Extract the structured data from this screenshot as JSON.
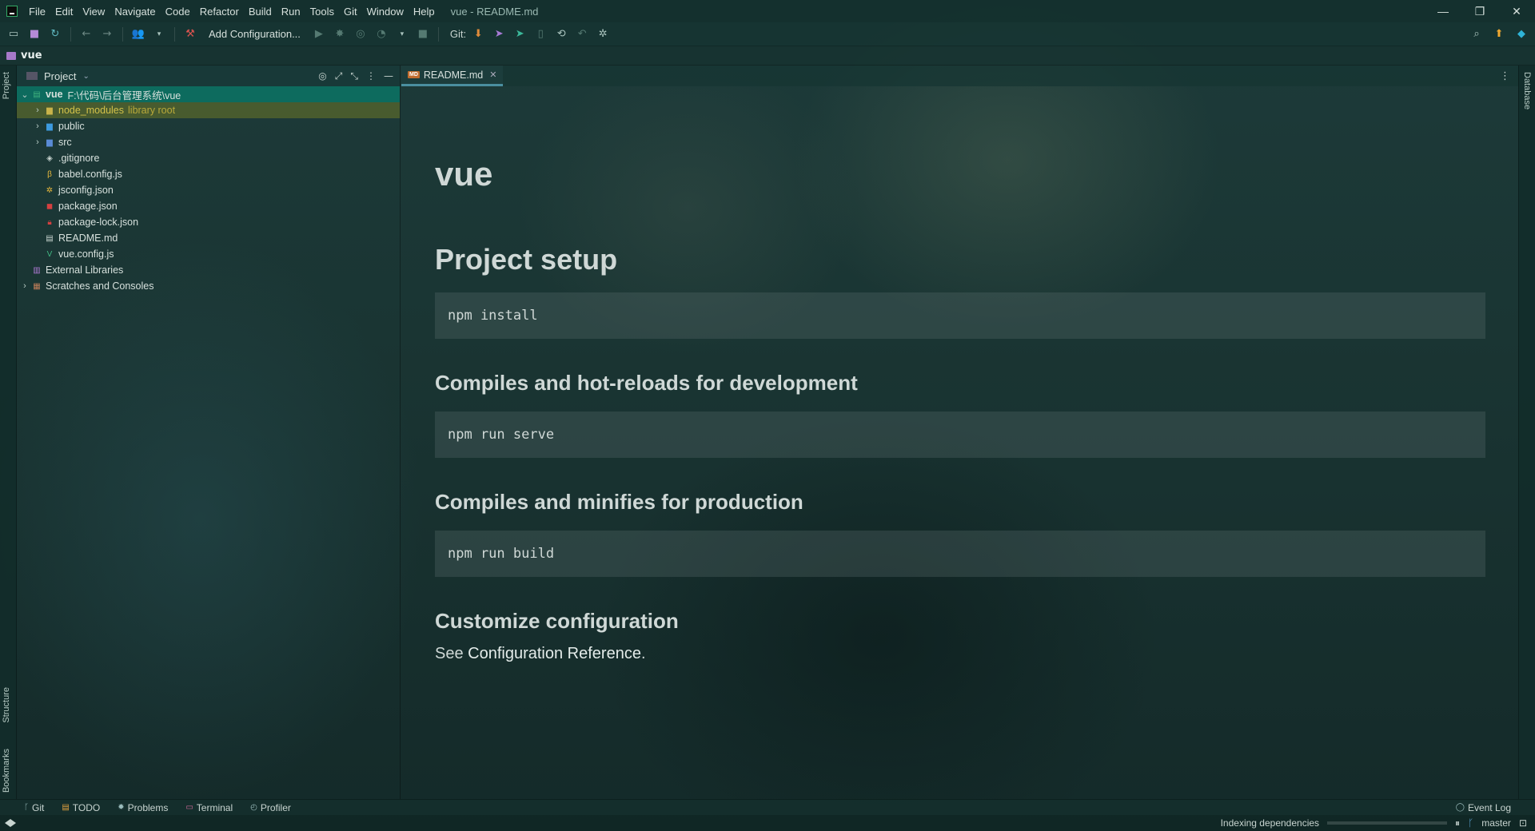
{
  "window": {
    "title": "vue - README.md",
    "menu": [
      "File",
      "Edit",
      "View",
      "Navigate",
      "Code",
      "Refactor",
      "Build",
      "Run",
      "Tools",
      "Git",
      "Window",
      "Help"
    ],
    "controls": {
      "minimize": "—",
      "restore": "❐",
      "close": "✕"
    }
  },
  "toolbar": {
    "add_configuration": "Add Configuration...",
    "git_label": "Git:"
  },
  "breadcrumb": {
    "project": "vue"
  },
  "side_tabs": {
    "project": "Project",
    "structure": "Structure",
    "bookmarks": "Bookmarks",
    "database": "Database"
  },
  "project_panel": {
    "title": "Project",
    "tree": [
      {
        "name": "vue",
        "extra": "F:\\代码\\后台管理系统\\vue"
      },
      {
        "name": "node_modules",
        "extra": "library root"
      },
      {
        "name": "public"
      },
      {
        "name": "src"
      },
      {
        "name": ".gitignore"
      },
      {
        "name": "babel.config.js"
      },
      {
        "name": "jsconfig.json"
      },
      {
        "name": "package.json"
      },
      {
        "name": "package-lock.json"
      },
      {
        "name": "README.md"
      },
      {
        "name": "vue.config.js"
      },
      {
        "name": "External Libraries"
      },
      {
        "name": "Scratches and Consoles"
      }
    ]
  },
  "editor": {
    "tab": {
      "label": "README.md",
      "icon_text": "MD"
    },
    "preview": {
      "h1": "vue",
      "sections": [
        {
          "heading": "Project setup",
          "code": "npm install"
        },
        {
          "heading": "Compiles and hot-reloads for development",
          "code": "npm run serve"
        },
        {
          "heading": "Compiles and minifies for production",
          "code": "npm run build"
        }
      ],
      "customize_heading": "Customize configuration",
      "see_text": "See ",
      "link_text": "Configuration Reference",
      "period": "."
    }
  },
  "tool_windows": {
    "git": "Git",
    "todo": "TODO",
    "problems": "Problems",
    "terminal": "Terminal",
    "profiler": "Profiler",
    "event_log": "Event Log"
  },
  "status": {
    "indexing": "Indexing dependencies",
    "indexing_progress": 0.0,
    "branch": "master"
  },
  "colors": {
    "selection": "#0d6b5e",
    "library_root": "#b9a93a",
    "accent": "#4a8fa0"
  }
}
